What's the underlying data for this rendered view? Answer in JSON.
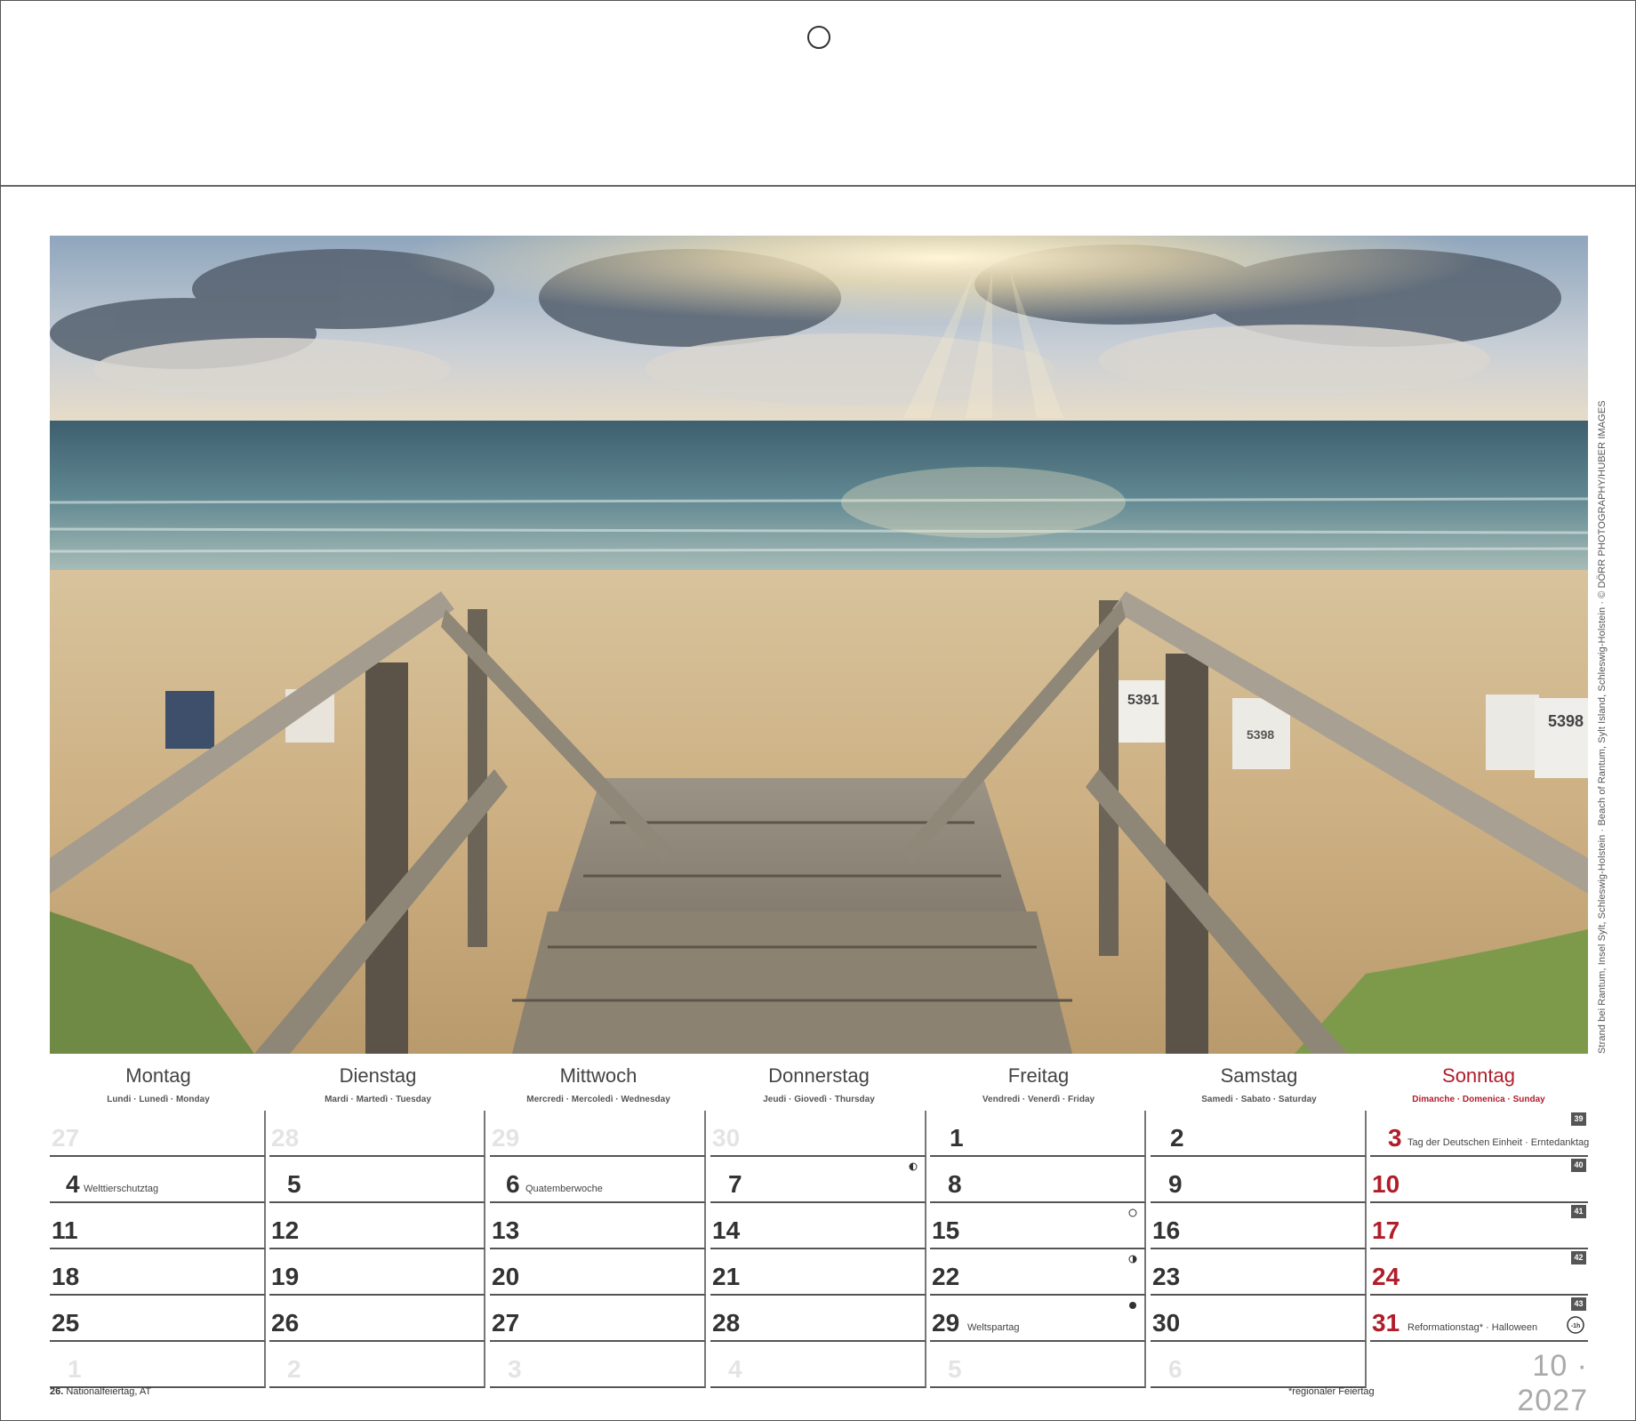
{
  "photo": {
    "caption": "Strand bei Rantum, Insel Sylt, Schleswig-Holstein · Beach of Rantum, Sylt Island, Schleswig-Holstein · © DÖRR PHOTOGRAPHY/HUBER IMAGES",
    "beach_chair_numbers": [
      "5391",
      "5398",
      "5398"
    ]
  },
  "weekdays": [
    {
      "name": "Montag",
      "sub": "Lundi · Lunedì · Monday"
    },
    {
      "name": "Dienstag",
      "sub": "Mardi · Martedì · Tuesday"
    },
    {
      "name": "Mittwoch",
      "sub": "Mercredi · Mercoledì · Wednesday"
    },
    {
      "name": "Donnerstag",
      "sub": "Jeudi · Giovedì · Thursday"
    },
    {
      "name": "Freitag",
      "sub": "Vendredi · Venerdì · Friday"
    },
    {
      "name": "Samstag",
      "sub": "Samedi · Sabato · Saturday"
    },
    {
      "name": "Sonntag",
      "sub": "Dimanche · Domenica · Sunday"
    }
  ],
  "week_numbers": [
    "39",
    "40",
    "41",
    "42",
    "43"
  ],
  "weeks": [
    [
      "27",
      "28",
      "29",
      "30",
      "1",
      "2",
      "3"
    ],
    [
      "4",
      "5",
      "6",
      "7",
      "8",
      "9",
      "10"
    ],
    [
      "11",
      "12",
      "13",
      "14",
      "15",
      "16",
      "17"
    ],
    [
      "18",
      "19",
      "20",
      "21",
      "22",
      "23",
      "24"
    ],
    [
      "25",
      "26",
      "27",
      "28",
      "29",
      "30",
      "31"
    ],
    [
      "1",
      "2",
      "3",
      "4",
      "5",
      "6",
      ""
    ]
  ],
  "events": {
    "oct3": "Tag der Deutschen Einheit · Erntedanktag",
    "oct4": "Welttierschutztag",
    "oct6": "Quatemberwoche",
    "oct29": "Weltspartag",
    "oct31": "Reformationstag* · Halloween"
  },
  "dst_badge": "-1h",
  "footnotes": {
    "left_day": "26.",
    "left_text": "Nationalfeiertag, AT",
    "right": "*regionaler Feiertag"
  },
  "month_label": "10 · 2027",
  "colors": {
    "sunday_red": "#b01e2a",
    "ghost_grey": "#e4e4e4",
    "week_badge": "#555555"
  }
}
